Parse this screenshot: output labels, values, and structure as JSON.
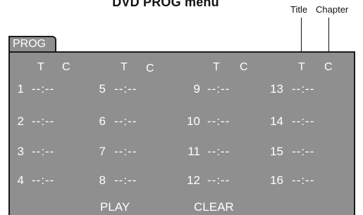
{
  "heading": "DVD PROG menu",
  "callouts": {
    "title": "Title",
    "chapter": "Chapter"
  },
  "tab_label": "PROG",
  "column_headers": [
    {
      "t": "T",
      "c": "C"
    },
    {
      "t": "T",
      "c": "C"
    },
    {
      "t": "T",
      "c": "C"
    },
    {
      "t": "T",
      "c": "C"
    }
  ],
  "slots": [
    {
      "n": "1",
      "v": "--:--"
    },
    {
      "n": "5",
      "v": "--:--"
    },
    {
      "n": "9",
      "v": "--:--"
    },
    {
      "n": "13",
      "v": "--:--"
    },
    {
      "n": "2",
      "v": "--:--"
    },
    {
      "n": "6",
      "v": "--:--"
    },
    {
      "n": "10",
      "v": "--:--"
    },
    {
      "n": "14",
      "v": "--:--"
    },
    {
      "n": "3",
      "v": "--:--"
    },
    {
      "n": "7",
      "v": "--:--"
    },
    {
      "n": "11",
      "v": "--:--"
    },
    {
      "n": "15",
      "v": "--:--"
    },
    {
      "n": "4",
      "v": "--:--"
    },
    {
      "n": "8",
      "v": "--:--"
    },
    {
      "n": "12",
      "v": "--:--"
    },
    {
      "n": "16",
      "v": "--:--"
    }
  ],
  "actions": {
    "play": "PLAY",
    "clear": "CLEAR"
  }
}
